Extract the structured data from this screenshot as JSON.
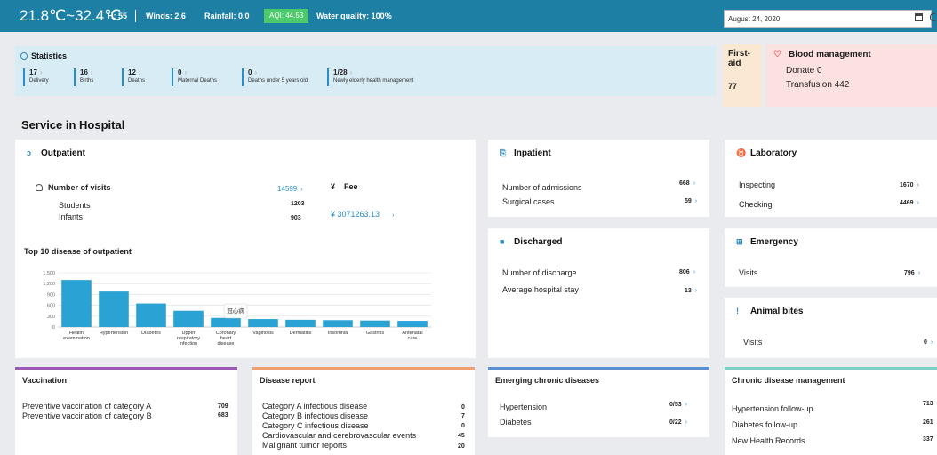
{
  "topbar": {
    "temperature": "21.8℃~32.4℃",
    "humidity": "H: 55",
    "winds": "Winds: 2.6",
    "rainfall": "Rainfall: 0.0",
    "aqi": "AQI: 44.53",
    "water_quality": "Water quality: 100%",
    "date": "August 24, 2020",
    "colors": {
      "bar": "#1e7fa4",
      "aqi_badge": "#4cc96a"
    }
  },
  "statistics": {
    "title": "Statistics",
    "items": [
      {
        "value": "17",
        "label": "Delivery"
      },
      {
        "value": "16",
        "label": "Births"
      },
      {
        "value": "12",
        "label": "Deaths"
      },
      {
        "value": "0",
        "label": "Maternal Deaths"
      },
      {
        "value": "0",
        "label": "Deaths under 5 years old"
      },
      {
        "value": "1/28",
        "label": "Newly elderly health management"
      }
    ]
  },
  "first_aid": {
    "title": "First-aid",
    "value": "77"
  },
  "blood": {
    "title": "Blood management",
    "donate": "Donate  0",
    "transfusion": "Transfusion  442"
  },
  "service_title": "Service in Hospital",
  "outpatient": {
    "title": "Outpatient",
    "visits_label": "Number of visits",
    "visits_value": "14599",
    "students_label": "Students",
    "students_value": "1203",
    "infants_label": "Infants",
    "infants_value": "903",
    "fee_label": "Fee",
    "fee_value": "¥ 3071263.13",
    "chart_title": "Top 10 disease of outpatient",
    "tooltip": "冠心病"
  },
  "chart_data": {
    "type": "bar",
    "title": "Top 10 disease of outpatient",
    "categories": [
      "Health examination",
      "Hypertension",
      "Diabetes",
      "Upper respiratory infection",
      "Coronary heart disease",
      "Vaginosis",
      "Dermatitis",
      "Insomnia",
      "Gastritis",
      "Antenatal care"
    ],
    "values": [
      1300,
      980,
      650,
      450,
      252,
      220,
      200,
      190,
      180,
      170
    ],
    "yticks": [
      "0",
      "300",
      "600",
      "900",
      "1,200",
      "1,500"
    ],
    "ylim": [
      0,
      1500
    ],
    "color": "#2aa3d4",
    "grid": true
  },
  "inpatient": {
    "title": "Inpatient",
    "rows": [
      {
        "label": "Number of admissions",
        "value": "668"
      },
      {
        "label": "Surgical cases",
        "value": "59"
      }
    ]
  },
  "discharged": {
    "title": "Discharged",
    "rows": [
      {
        "label": "Number of discharge",
        "value": "806"
      },
      {
        "label": "Average hospital stay",
        "value": "13"
      }
    ]
  },
  "laboratory": {
    "title": "Laboratory",
    "rows": [
      {
        "label": "Inspecting",
        "value": "1670"
      },
      {
        "label": "Checking",
        "value": "4469"
      }
    ]
  },
  "emergency": {
    "title": "Emergency",
    "rows": [
      {
        "label": "Visits",
        "value": "796"
      }
    ]
  },
  "animal_bites": {
    "title": "Animal bites",
    "rows": [
      {
        "label": "Visits",
        "value": "0"
      }
    ]
  },
  "vaccination": {
    "title": "Vaccination",
    "rows": [
      {
        "label": "Preventive vaccination of category A",
        "value": "709"
      },
      {
        "label": "Preventive vaccination of category B",
        "value": "683"
      }
    ]
  },
  "disease_report": {
    "title": "Disease report",
    "rows": [
      {
        "label": "Category A infectious disease",
        "value": "0"
      },
      {
        "label": "Category B infectious disease",
        "value": "7"
      },
      {
        "label": "Category C infectious disease",
        "value": "0"
      },
      {
        "label": "Cardiovascular and cerebrovascular events",
        "value": "45"
      },
      {
        "label": "Malignant tumor reports",
        "value": "20"
      }
    ]
  },
  "emerging_chronic": {
    "title": "Emerging chronic diseases",
    "rows": [
      {
        "label": "Hypertension",
        "value": "0/53"
      },
      {
        "label": "Diabetes",
        "value": "0/22"
      }
    ]
  },
  "chronic_mgmt": {
    "title": "Chronic disease management",
    "rows": [
      {
        "label": "Hypertension follow-up",
        "value": "713"
      },
      {
        "label": "Diabetes follow-up",
        "value": "261"
      },
      {
        "label": "New Health Records",
        "value": "337"
      }
    ]
  },
  "accent_colors": {
    "vaccination": "#9b59b6",
    "disease_report": "#f0a070",
    "emerging": "#5b8fd0",
    "chronic": "#7ecfc7"
  }
}
